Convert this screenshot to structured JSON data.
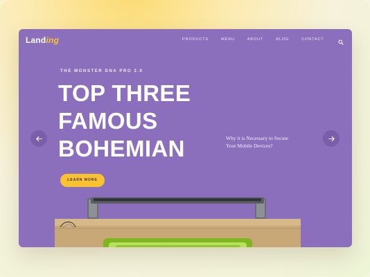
{
  "brand": {
    "logo_main": "Land",
    "logo_accent": "ing"
  },
  "nav": {
    "items": [
      "PRODUCTS",
      "MENU",
      "ABOUT",
      "BLOG",
      "CONTACT"
    ],
    "search_icon": "search-icon"
  },
  "hero": {
    "eyebrow": "THE MONSTER DNA PRO 2.0",
    "headline_lines": [
      "TOP THREE",
      "FAMOUS",
      "BOHEMIAN"
    ],
    "cta_label": "LEARN MORE",
    "side_text": "Why it is Necessary to Secure Your Mobile Devices?"
  },
  "carousel": {
    "prev_icon": "arrow-left-icon",
    "next_icon": "arrow-right-icon"
  },
  "colors": {
    "card_background": "#8b6fbd",
    "accent": "#f9c22e",
    "arrow_button": "#7a5ea9",
    "text": "#ffffff"
  }
}
